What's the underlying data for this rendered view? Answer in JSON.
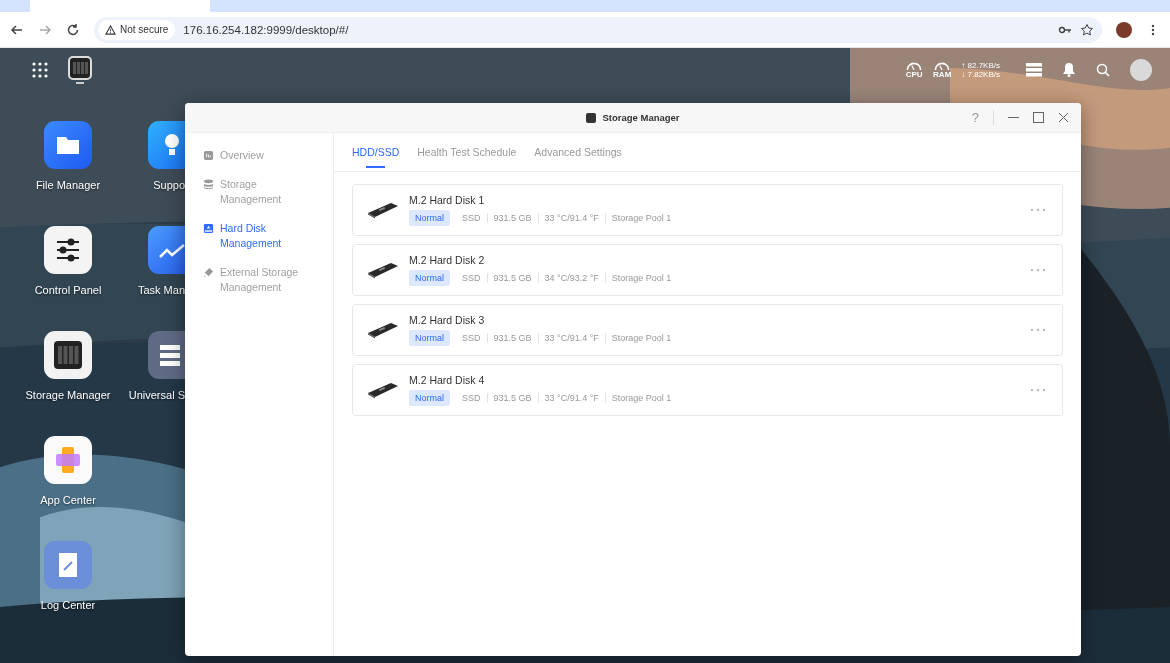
{
  "browser": {
    "security": "Not secure",
    "url": "176.16.254.182:9999/desktop/#/"
  },
  "topbar": {
    "gauges": [
      {
        "label": "CPU"
      },
      {
        "label": "RAM"
      }
    ],
    "upload": "↑ 82.7KB/s",
    "download": "↓ 7.82KB/s"
  },
  "desktop_icons": [
    {
      "label": "File Manager",
      "kind": "folder"
    },
    {
      "label": "Control Panel",
      "kind": "sliders"
    },
    {
      "label": "Storage Manager",
      "kind": "storage"
    },
    {
      "label": "App Center",
      "kind": "apps"
    },
    {
      "label": "Log Center",
      "kind": "log"
    },
    {
      "label": "Suppo",
      "kind": "bulb"
    },
    {
      "label": "Task Man",
      "kind": "chart"
    },
    {
      "label": "Universal S",
      "kind": "server"
    }
  ],
  "window": {
    "title": "Storage Manager",
    "help": "?",
    "sidebar": [
      {
        "label": "Overview",
        "kind": "overview",
        "selected": false
      },
      {
        "label": "Storage Management",
        "kind": "database",
        "selected": false
      },
      {
        "label": "Hard Disk Management",
        "kind": "disk",
        "selected": true
      },
      {
        "label": "External Storage Management",
        "kind": "usb",
        "selected": false
      }
    ],
    "tabs": [
      {
        "label": "HDD/SSD",
        "selected": true
      },
      {
        "label": "Health Test Schedule",
        "selected": false
      },
      {
        "label": "Advanced Settings",
        "selected": false
      }
    ],
    "disks": [
      {
        "name": "M.2 Hard Disk 1",
        "status": "Normal",
        "type": "SSD",
        "capacity": "931.5 GB",
        "temperature": "33 °C/91.4 °F",
        "pool": "Storage Pool 1"
      },
      {
        "name": "M.2 Hard Disk 2",
        "status": "Normal",
        "type": "SSD",
        "capacity": "931.5 GB",
        "temperature": "34 °C/93.2 °F",
        "pool": "Storage Pool 1"
      },
      {
        "name": "M.2 Hard Disk 3",
        "status": "Normal",
        "type": "SSD",
        "capacity": "931.5 GB",
        "temperature": "33 °C/91.4 °F",
        "pool": "Storage Pool 1"
      },
      {
        "name": "M.2 Hard Disk 4",
        "status": "Normal",
        "type": "SSD",
        "capacity": "931.5 GB",
        "temperature": "33 °C/91.4 °F",
        "pool": "Storage Pool 1"
      }
    ]
  }
}
